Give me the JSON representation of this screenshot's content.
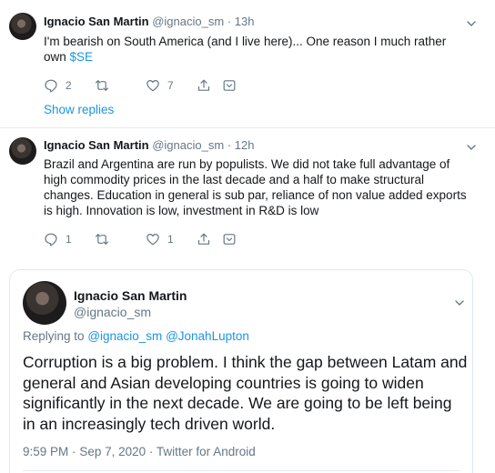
{
  "tweet1": {
    "name": "Ignacio San Martin",
    "handle": "@ignacio_sm",
    "separator": "·",
    "time": "13h",
    "text_line1": "I'm bearish on South America (and I live here)... One reason I much rather",
    "text_line2_prefix": "own ",
    "cashtag": "$SE",
    "reply_count": "2",
    "retweet_count": "",
    "like_count": "7",
    "show_replies": "Show replies"
  },
  "tweet2": {
    "name": "Ignacio San Martin",
    "handle": "@ignacio_sm",
    "separator": "·",
    "time": "12h",
    "text_lines": [
      "Brazil and Argentina are run by populists. We did not take full advantage of",
      "high commodity prices in the last decade and a half to make structural",
      "changes. Education in general is sub par, reliance of non value added exports",
      "is high. Innovation is low, investment in R&D is low"
    ],
    "reply_count": "1",
    "retweet_count": "",
    "like_count": "1"
  },
  "focused": {
    "name": "Ignacio San Martin",
    "handle": "@ignacio_sm",
    "replying_prefix": "Replying to",
    "reply_to_1": "@ignacio_sm",
    "reply_to_2": "@JonahLupton",
    "text_lines": [
      "Corruption is a big problem. I think the gap between Latam and",
      "general and Asian developing countries is going to widen",
      "significantly in the next decade. We are going to be left being",
      "in an increasingly tech driven world."
    ],
    "time": "9:59 PM",
    "date": "Sep 7, 2020",
    "source": "Twitter for Android",
    "separator": "·"
  },
  "icons": {
    "reply": "reply-icon",
    "retweet": "retweet-icon",
    "like": "heart-icon",
    "share": "share-icon",
    "analytics": "analytics-icon",
    "more": "chevron-down-icon"
  },
  "colors": {
    "link": "#1b95e0",
    "secondary_text": "#657786",
    "primary_text": "#14171a",
    "border": "#e1e8ed"
  }
}
